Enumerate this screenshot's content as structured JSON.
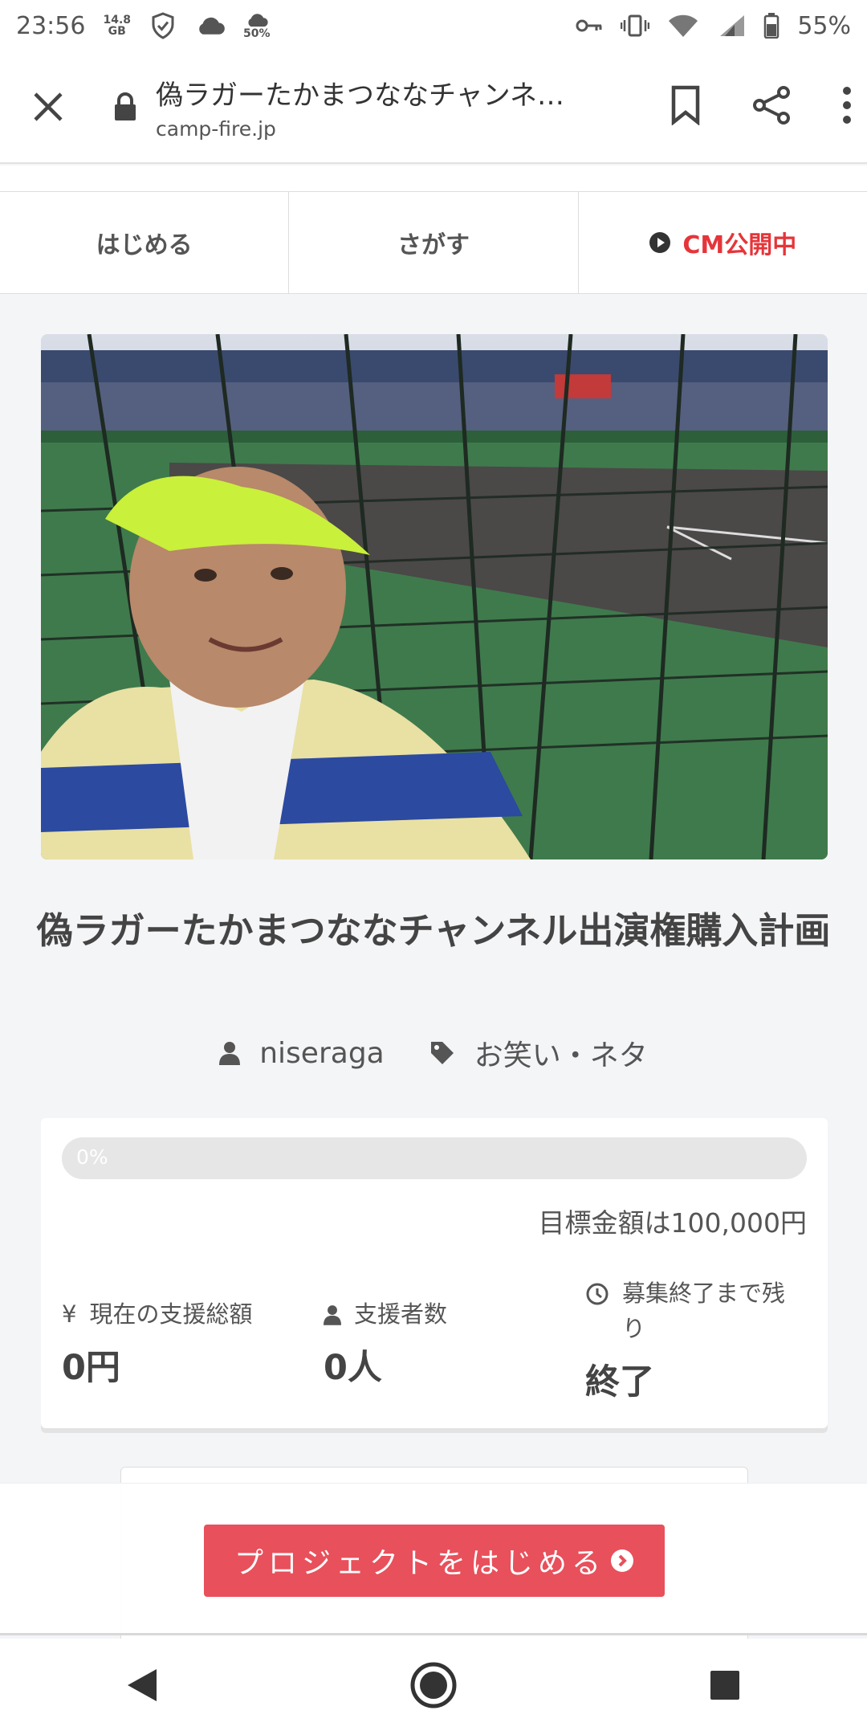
{
  "status_bar": {
    "time": "23:56",
    "storage_top": "14.8",
    "storage_bottom": "GB",
    "cloud_percent": "50%",
    "battery": "55%"
  },
  "browser": {
    "title": "偽ラガーたかまつななチャンネ…",
    "url": "camp-fire.jp"
  },
  "site_nav": {
    "start": "はじめる",
    "search": "さがす",
    "cm": "CM公開中"
  },
  "project": {
    "title": "偽ラガーたかまつななチャンネル出演権購入計画",
    "author": "niseraga",
    "category": "お笑い・ネタ"
  },
  "stats": {
    "progress_label": "0%",
    "progress_value": 0,
    "goal": "目標金額は100,000円",
    "total_label": "現在の支援総額",
    "total_value": "0円",
    "backers_label": "支援者数",
    "backers_value": "0人",
    "remaining_label": "募集終了まで残り",
    "remaining_value": "終了",
    "yen_icon": "¥"
  },
  "cta": {
    "label": "プロジェクトをはじめる"
  },
  "colors": {
    "accent": "#e8505b",
    "cm_red": "#e5353a"
  }
}
